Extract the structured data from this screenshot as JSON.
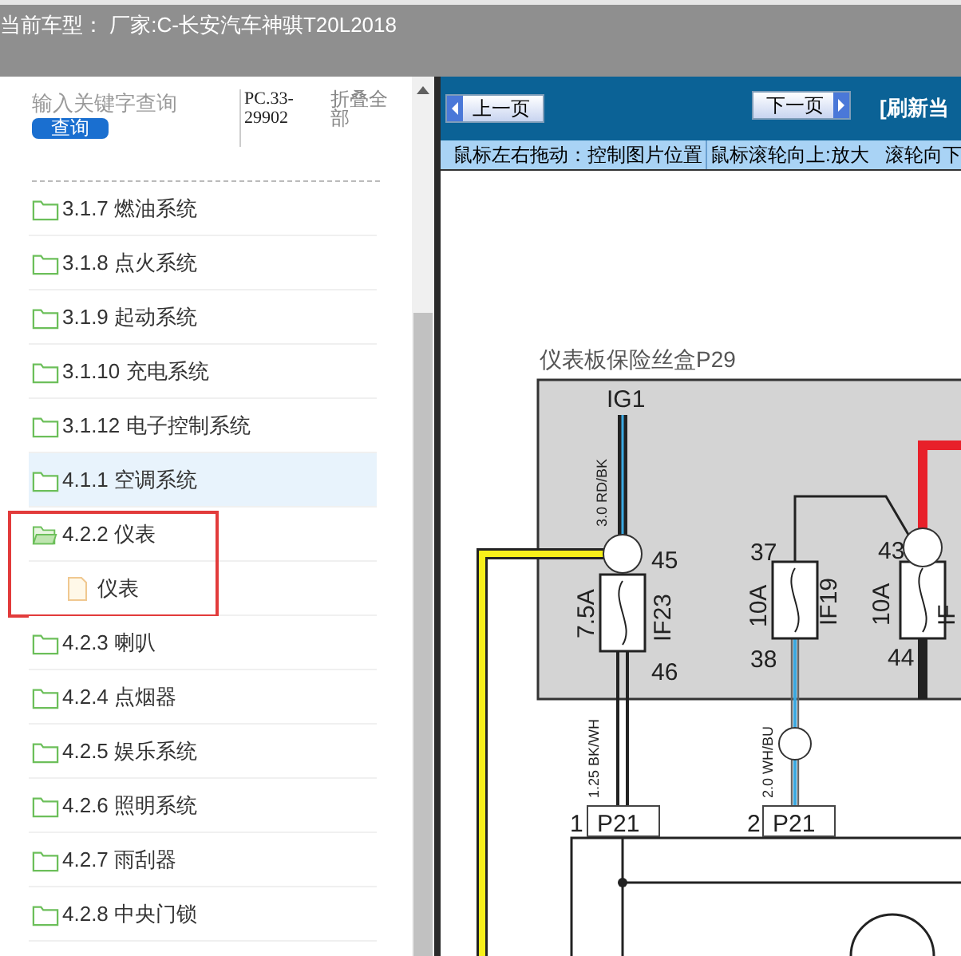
{
  "header": {
    "title": "当前车型：  厂家:C-长安汽车神骐T20L2018"
  },
  "search": {
    "placeholder": "输入关键字查询",
    "button": "查询",
    "code": "PC.33-29902",
    "collapse_all": "折叠全部"
  },
  "tree": [
    {
      "label": "3.1.7 燃油系统",
      "kind": "folder",
      "selected": false,
      "expanded": false,
      "annotated": false
    },
    {
      "label": "3.1.8 点火系统",
      "kind": "folder",
      "selected": false,
      "expanded": false,
      "annotated": false
    },
    {
      "label": "3.1.9 起动系统",
      "kind": "folder",
      "selected": false,
      "expanded": false,
      "annotated": false
    },
    {
      "label": "3.1.10 充电系统",
      "kind": "folder",
      "selected": false,
      "expanded": false,
      "annotated": false
    },
    {
      "label": "3.1.12 电子控制系统",
      "kind": "folder",
      "selected": false,
      "expanded": false,
      "annotated": false
    },
    {
      "label": "4.1.1 空调系统",
      "kind": "folder",
      "selected": true,
      "expanded": false,
      "annotated": false
    },
    {
      "label": "4.2.2 仪表",
      "kind": "folder",
      "selected": false,
      "expanded": true,
      "annotated": true,
      "children": [
        {
          "label": "仪表",
          "kind": "file",
          "selected": false
        }
      ]
    },
    {
      "label": "4.2.3 喇叭",
      "kind": "folder",
      "selected": false,
      "expanded": false,
      "annotated": false
    },
    {
      "label": "4.2.4 点烟器",
      "kind": "folder",
      "selected": false,
      "expanded": false,
      "annotated": false
    },
    {
      "label": "4.2.5 娱乐系统",
      "kind": "folder",
      "selected": false,
      "expanded": false,
      "annotated": false
    },
    {
      "label": "4.2.6 照明系统",
      "kind": "folder",
      "selected": false,
      "expanded": false,
      "annotated": false
    },
    {
      "label": "4.2.7 雨刮器",
      "kind": "folder",
      "selected": false,
      "expanded": false,
      "annotated": false
    },
    {
      "label": "4.2.8 中央门锁",
      "kind": "folder",
      "selected": false,
      "expanded": false,
      "annotated": false
    }
  ],
  "viewer": {
    "prev": "上一页",
    "next": "下一页",
    "refresh": "[刷新当",
    "hints": [
      {
        "text": "鼠标左右拖动：控制图片位置",
        "divider": false
      },
      {
        "text": "鼠标滚轮向上:放大",
        "divider": true
      },
      {
        "text": "滚轮向下",
        "divider": false
      }
    ],
    "diagram": {
      "title": "仪表板保险丝盒P29",
      "labels": [
        "IG1",
        "3.0 RD/BK",
        "45",
        "7.5A",
        "IF23",
        "46",
        "37",
        "38",
        "10A",
        "IF19",
        "43",
        "44",
        "10A",
        "IF",
        "1.25 BK/WH",
        "2.0 WH/BU",
        "1",
        "P21",
        "2",
        "P21"
      ]
    }
  }
}
